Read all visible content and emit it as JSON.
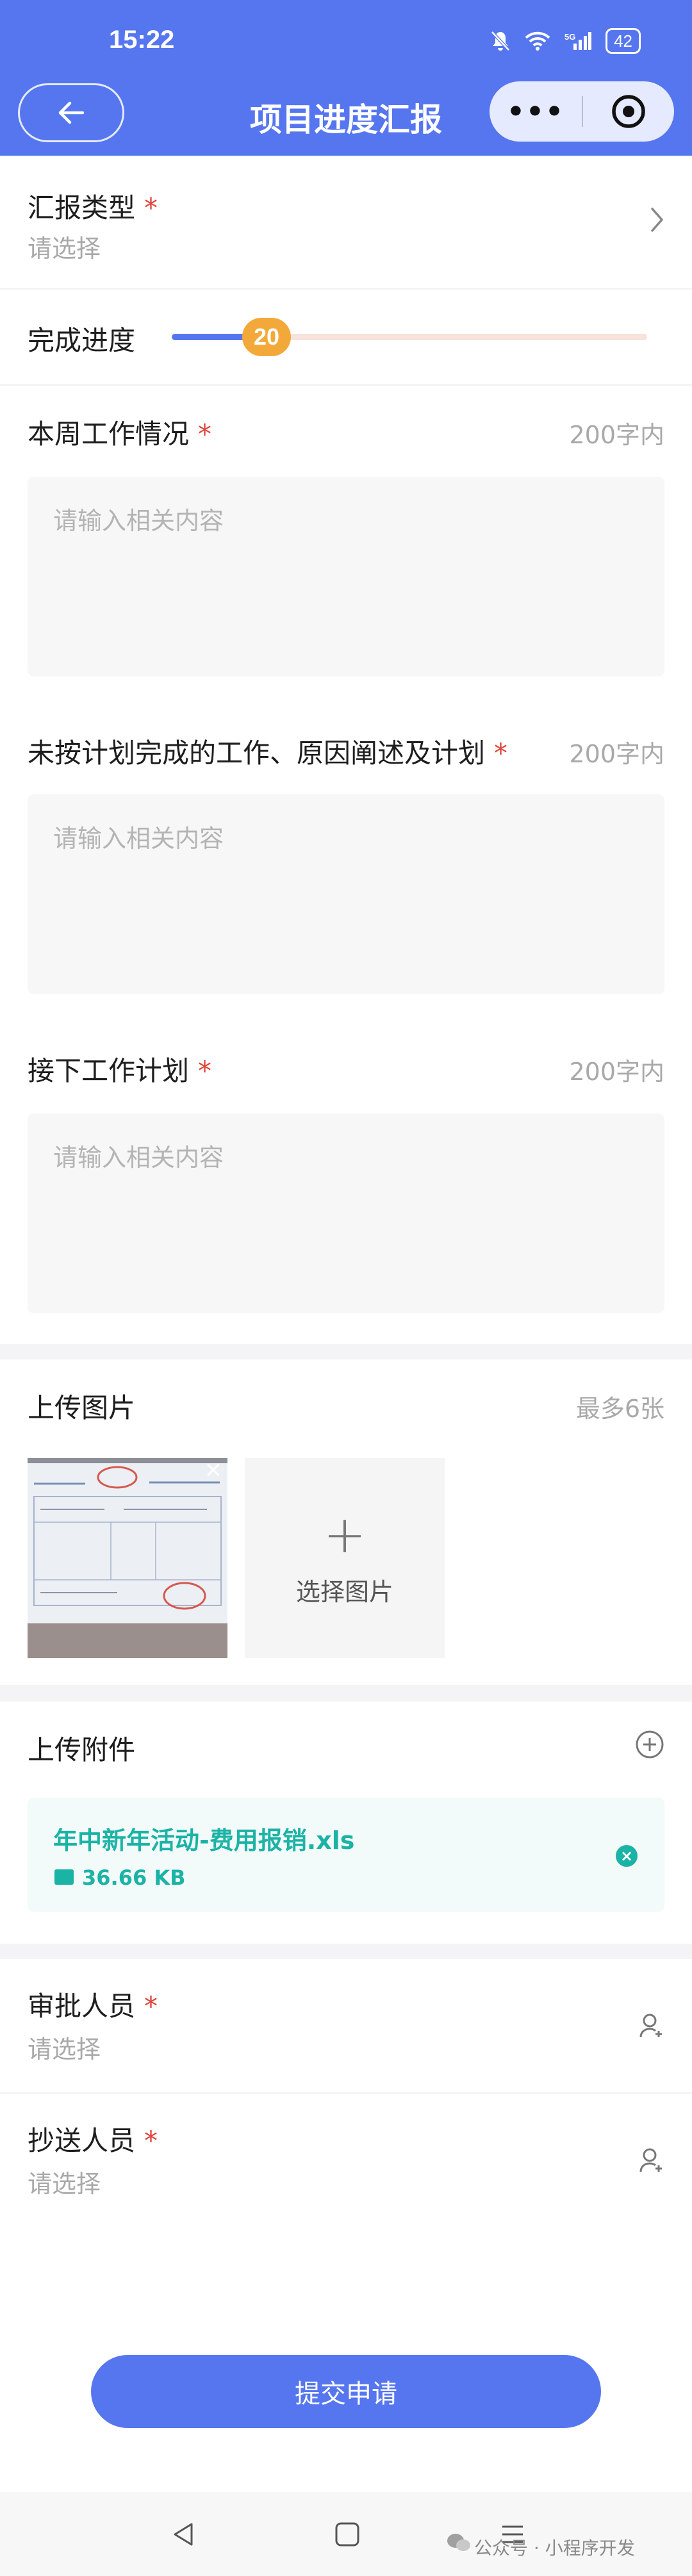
{
  "status_bar": {
    "time": "15:22",
    "battery": "42",
    "network": "5G"
  },
  "header": {
    "title": "项目进度汇报",
    "more_label": "•••"
  },
  "form": {
    "report_type": {
      "label": "汇报类型",
      "required": "*",
      "placeholder": "请选择"
    },
    "progress": {
      "label": "完成进度",
      "value": "20",
      "fraction": 0.2
    },
    "weekly_work": {
      "label": "本周工作情况",
      "required": "*",
      "limit": "200字内",
      "placeholder": "请输入相关内容",
      "value": ""
    },
    "unfinished": {
      "label": "未按计划完成的工作、原因阐述及计划",
      "required": "*",
      "limit": "200字内",
      "placeholder": "请输入相关内容",
      "value": ""
    },
    "next_plan": {
      "label": "接下工作计划",
      "required": "*",
      "limit": "200字内",
      "placeholder": "请输入相关内容",
      "value": ""
    },
    "images": {
      "label": "上传图片",
      "hint": "最多6张",
      "add_label": "选择图片",
      "remove": "×"
    },
    "attachments": {
      "label": "上传附件",
      "files": [
        {
          "name": "年中新年活动-费用报销.xls",
          "size": "36.66 KB"
        }
      ]
    },
    "approver": {
      "label": "审批人员",
      "required": "*",
      "placeholder": "请选择"
    },
    "cc": {
      "label": "抄送人员",
      "required": "*",
      "placeholder": "请选择"
    }
  },
  "submit_label": "提交申请",
  "watermark": "公众号 · 小程序开发",
  "colors": {
    "primary": "#5676f0",
    "required": "#e0433a",
    "attachment": "#1bb3a6",
    "slider_thumb": "#f3a93a"
  }
}
